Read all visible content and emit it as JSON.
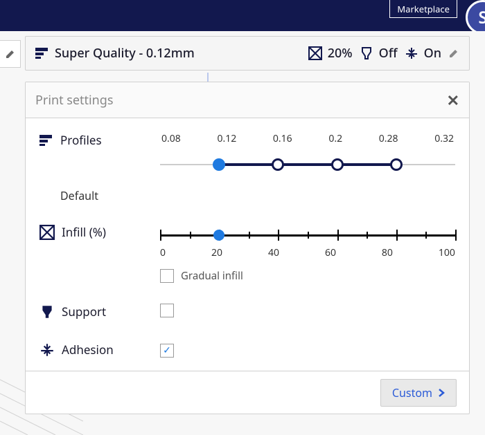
{
  "topbar": {
    "marketplace_label": "Marketplace",
    "avatar_initial": "S"
  },
  "summary": {
    "profile_label": "Super Quality - 0.12mm",
    "infill_value": "20%",
    "support_value": "Off",
    "adhesion_value": "On"
  },
  "panel": {
    "title": "Print settings",
    "profiles_label": "Profiles",
    "profiles_sub": "Default",
    "profile_ticks": [
      "0.08",
      "0.12",
      "0.16",
      "0.2",
      "0.28",
      "0.32"
    ],
    "profile_selected_index": 1,
    "profile_active_end_index": 4,
    "infill_label": "Infill (%)",
    "infill_labels": [
      "0",
      "20",
      "40",
      "60",
      "80",
      "100"
    ],
    "infill_value_pct": 20,
    "gradual_label": "Gradual infill",
    "gradual_checked": false,
    "support_label": "Support",
    "support_checked": false,
    "adhesion_label": "Adhesion",
    "adhesion_checked": true,
    "custom_label": "Custom"
  }
}
